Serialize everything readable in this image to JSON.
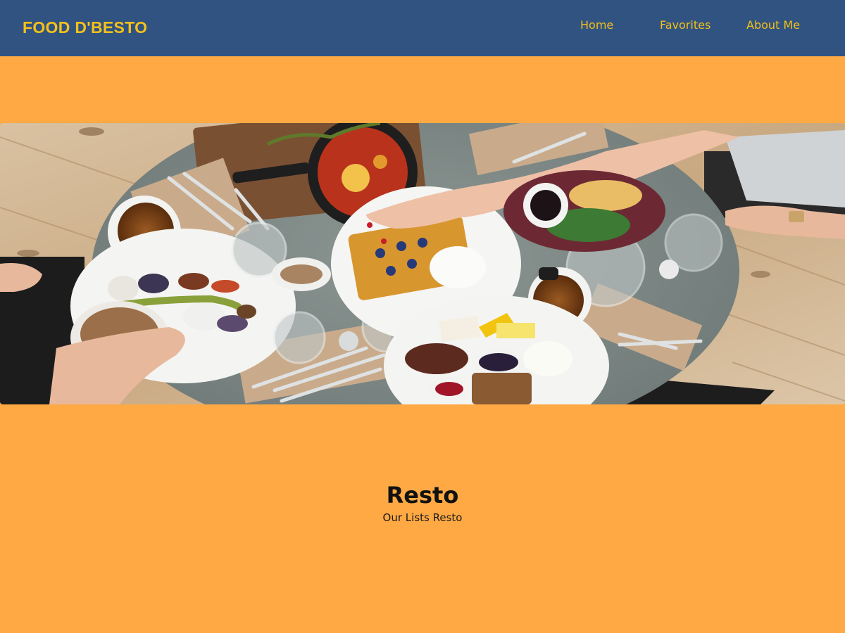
{
  "header": {
    "brand": "FOOD D'BESTO",
    "nav": [
      {
        "label": "Home"
      },
      {
        "label": "Favorites"
      },
      {
        "label": "About Me"
      }
    ]
  },
  "hero": {
    "image": "hero-breakfast-table-image"
  },
  "main": {
    "title": "Resto",
    "subtitle": "Our Lists Resto"
  },
  "colors": {
    "header_bg": "#305381",
    "brand_accent": "#F4C01B",
    "page_bg": "#FFA944"
  }
}
